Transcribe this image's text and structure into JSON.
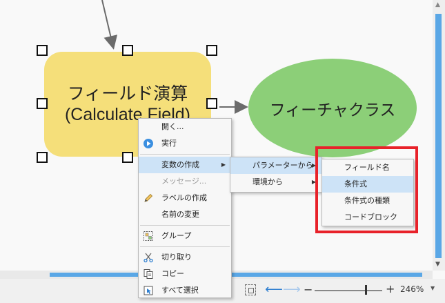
{
  "model": {
    "tool_line1": "フィールド演算",
    "tool_line2": "(Calculate Field)",
    "data_label": "フィーチャクラス"
  },
  "context_menu": {
    "items": [
      {
        "label": "開く...",
        "disabled": false,
        "icon": "none"
      },
      {
        "label": "実行",
        "disabled": false,
        "icon": "play-icon"
      },
      {
        "label": "変数の作成",
        "disabled": false,
        "icon": "none",
        "highlighted": true,
        "submenu": true
      },
      {
        "label": "メッセージ...",
        "disabled": true,
        "icon": "none"
      },
      {
        "label": "ラベルの作成",
        "disabled": false,
        "icon": "pencil-icon"
      },
      {
        "label": "名前の変更",
        "disabled": false,
        "icon": "none"
      },
      {
        "label": "グループ",
        "disabled": false,
        "icon": "group-icon"
      },
      {
        "label": "切り取り",
        "disabled": false,
        "icon": "scissors-icon"
      },
      {
        "label": "コピー",
        "disabled": false,
        "icon": "copy-icon"
      },
      {
        "label": "すべて選択",
        "disabled": false,
        "icon": "select-all-icon"
      }
    ]
  },
  "variable_submenu": {
    "items": [
      {
        "label": "パラメーターから",
        "highlighted": true
      },
      {
        "label": "環境から",
        "highlighted": false
      }
    ]
  },
  "parameter_submenu": {
    "items": [
      {
        "label": "フィールド名",
        "highlighted": false
      },
      {
        "label": "条件式",
        "highlighted": true
      },
      {
        "label": "条件式の種類",
        "highlighted": false
      },
      {
        "label": "コードブロック",
        "highlighted": false
      }
    ]
  },
  "statusbar": {
    "zoom_label": "246%",
    "zoom_slider_fraction": 0.76
  },
  "colors": {
    "tool_fill": "#f5df7a",
    "data_fill": "#8ccf78",
    "highlight": "#cde3f7",
    "annotation_red": "#e8222a",
    "scrollbar_accent": "#5aa7e6"
  }
}
